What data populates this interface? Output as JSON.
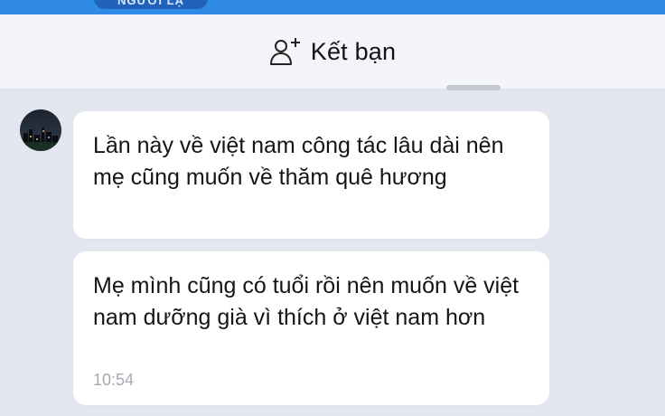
{
  "header": {
    "title_partial": "NGƯỜI LẠ",
    "accent_color": "#2f8ae6",
    "action": {
      "icon": "add-friend-icon",
      "label": "Kết bạn"
    }
  },
  "contact": {
    "avatar": "avatar-night-city-image"
  },
  "messages": [
    {
      "text": "Lần này về việt nam công tác lâu dài nên mẹ cũng muốn về thăm quê hương",
      "time": ""
    },
    {
      "text": "Mẹ mình cũng có tuổi rồi nên muốn về việt nam dưỡng già vì thích ở việt nam hơn",
      "time": "10:54"
    }
  ]
}
